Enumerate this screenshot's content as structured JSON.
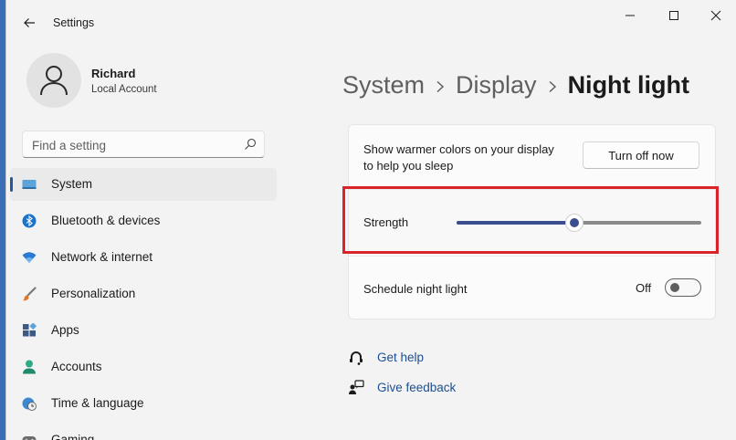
{
  "window": {
    "app_title": "Settings"
  },
  "user": {
    "name": "Richard",
    "account_type": "Local Account"
  },
  "search": {
    "placeholder": "Find a setting"
  },
  "sidebar": {
    "items": [
      {
        "label": "System",
        "icon": "monitor-icon",
        "selected": true
      },
      {
        "label": "Bluetooth & devices",
        "icon": "bluetooth-icon"
      },
      {
        "label": "Network & internet",
        "icon": "wifi-icon"
      },
      {
        "label": "Personalization",
        "icon": "paintbrush-icon"
      },
      {
        "label": "Apps",
        "icon": "apps-icon"
      },
      {
        "label": "Accounts",
        "icon": "person-icon"
      },
      {
        "label": "Time & language",
        "icon": "globe-clock-icon"
      },
      {
        "label": "Gaming",
        "icon": "gamepad-icon"
      }
    ]
  },
  "breadcrumb": {
    "items": [
      "System",
      "Display",
      "Night light"
    ]
  },
  "night_light": {
    "description": "Show warmer colors on your display to help you sleep",
    "turn_off_label": "Turn off now",
    "strength_label": "Strength",
    "strength_fraction": 0.48,
    "schedule_label": "Schedule night light",
    "schedule_state": "Off",
    "schedule_on": false
  },
  "links": {
    "get_help": "Get help",
    "give_feedback": "Give feedback"
  },
  "colors": {
    "accent": "#3b4f8f",
    "highlight_box": "#d9242c",
    "link": "#1d4f91"
  }
}
